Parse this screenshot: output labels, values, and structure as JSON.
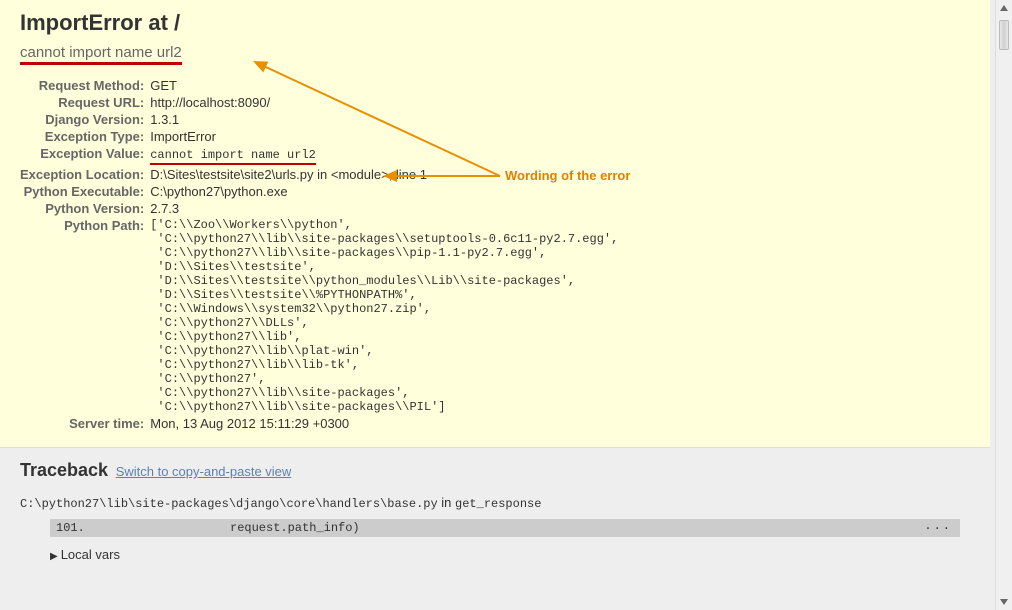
{
  "error": {
    "title_prefix": "ImportError at ",
    "path": "/",
    "message": "cannot import name url2"
  },
  "meta": {
    "request_method_label": "Request Method:",
    "request_method": "GET",
    "request_url_label": "Request URL:",
    "request_url": "http://localhost:8090/",
    "django_version_label": "Django Version:",
    "django_version": "1.3.1",
    "exception_type_label": "Exception Type:",
    "exception_type": "ImportError",
    "exception_value_label": "Exception Value:",
    "exception_value": "cannot import name url2",
    "exception_location_label": "Exception Location:",
    "exception_location": "D:\\Sites\\testsite\\site2\\urls.py in <module>, line 1",
    "python_exe_label": "Python Executable:",
    "python_exe": "C:\\python27\\python.exe",
    "python_version_label": "Python Version:",
    "python_version": "2.7.3",
    "python_path_label": "Python Path:",
    "python_path": "['C:\\\\Zoo\\\\Workers\\\\python',\n 'C:\\\\python27\\\\lib\\\\site-packages\\\\setuptools-0.6c11-py2.7.egg',\n 'C:\\\\python27\\\\lib\\\\site-packages\\\\pip-1.1-py2.7.egg',\n 'D:\\\\Sites\\\\testsite',\n 'D:\\\\Sites\\\\testsite\\\\python_modules\\\\Lib\\\\site-packages',\n 'D:\\\\Sites\\\\testsite\\\\%PYTHONPATH%',\n 'C:\\\\Windows\\\\system32\\\\python27.zip',\n 'C:\\\\python27\\\\DLLs',\n 'C:\\\\python27\\\\lib',\n 'C:\\\\python27\\\\lib\\\\plat-win',\n 'C:\\\\python27\\\\lib\\\\lib-tk',\n 'C:\\\\python27',\n 'C:\\\\python27\\\\lib\\\\site-packages',\n 'C:\\\\python27\\\\lib\\\\site-packages\\\\PIL']",
    "server_time_label": "Server time:",
    "server_time": "Mon, 13 Aug 2012 15:11:29 +0300"
  },
  "traceback": {
    "heading": "Traceback",
    "switch_link": "Switch to copy-and-paste view",
    "frame": {
      "file": "C:\\python27\\lib\\site-packages\\django\\core\\handlers\\base.py",
      "in_word": " in ",
      "func": "get_response",
      "lineno": "101.",
      "code": "request.path_info)",
      "dots": "...",
      "local_vars_label": "Local vars"
    }
  },
  "annotation": {
    "label": "Wording of the error"
  }
}
